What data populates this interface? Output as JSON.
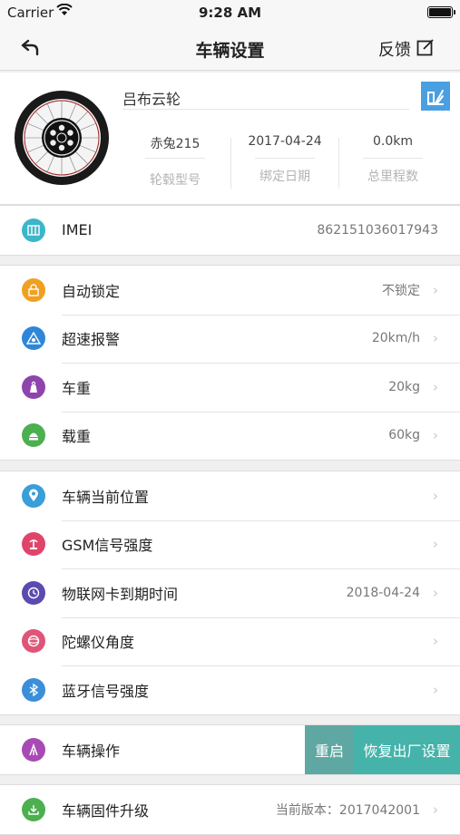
{
  "status": {
    "carrier": "Carrier",
    "time": "9:28 AM"
  },
  "nav": {
    "title": "车辆设置",
    "feedback": "反馈"
  },
  "vehicle": {
    "name": "吕布云轮",
    "stats": [
      {
        "value": "赤兔215",
        "label": "轮毂型号"
      },
      {
        "value": "2017-04-24",
        "label": "绑定日期"
      },
      {
        "value": "0.0km",
        "label": "总里程数"
      }
    ]
  },
  "imei": {
    "label": "IMEI",
    "value": "862151036017943",
    "icon": "imei-icon"
  },
  "group1": [
    {
      "label": "自动锁定",
      "value": "不锁定",
      "icon": "lock-icon",
      "color": "#f0a020"
    },
    {
      "label": "超速报警",
      "value": "20km/h",
      "icon": "speed-alert-icon",
      "color": "#2f86d8"
    },
    {
      "label": "车重",
      "value": "20kg",
      "icon": "weight-icon",
      "color": "#8e44ad"
    },
    {
      "label": "载重",
      "value": "60kg",
      "icon": "load-icon",
      "color": "#4caf50"
    }
  ],
  "group2": [
    {
      "label": "车辆当前位置",
      "value": "",
      "icon": "location-icon",
      "color": "#3a9ed8"
    },
    {
      "label": "GSM信号强度",
      "value": "",
      "icon": "signal-icon",
      "color": "#e0446a"
    },
    {
      "label": "物联网卡到期时间",
      "value": "2018-04-24",
      "icon": "clock-icon",
      "color": "#5b4bb0"
    },
    {
      "label": "陀螺仪角度",
      "value": "",
      "icon": "gyroscope-icon",
      "color": "#e05577"
    },
    {
      "label": "蓝牙信号强度",
      "value": "",
      "icon": "bluetooth-icon",
      "color": "#3b8fd9"
    }
  ],
  "operation": {
    "label": "车辆操作",
    "icon": "operation-icon",
    "color": "#a84ab4",
    "restart": "重启",
    "reset": "恢复出厂设置"
  },
  "firmware": {
    "label": "车辆固件升级",
    "value": "当前版本：2017042001",
    "icon": "firmware-icon",
    "color": "#4caf50"
  }
}
